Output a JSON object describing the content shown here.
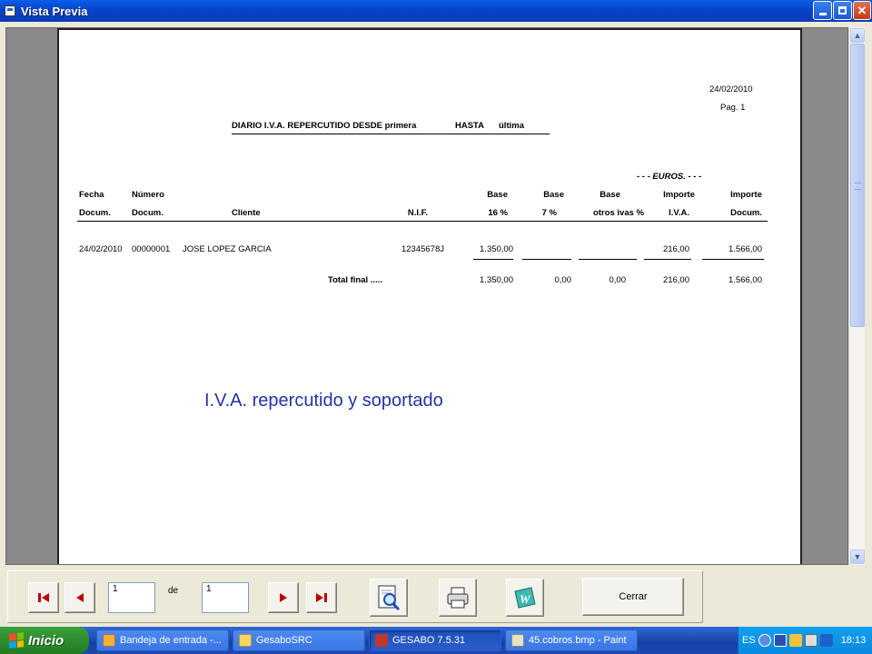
{
  "window": {
    "title": "Vista Previa"
  },
  "report": {
    "date": "24/02/2010",
    "page": "Pag.  1",
    "title": "DIARIO I.V.A. REPERCUTIDO DESDE primera",
    "hasta": "HASTA",
    "hasta_value": "última",
    "currency_caption": "- - - EUROS. - - -",
    "headers_row1": [
      "Fecha",
      "Número",
      "Base",
      "Base",
      "Base",
      "Importe",
      "Importe"
    ],
    "headers_row2": [
      "Docum.",
      "Docum.",
      "Cliente",
      "N.I.F.",
      "16 %",
      "7 %",
      "otros ivas %",
      "I.V.A.",
      "Docum."
    ],
    "rows": [
      {
        "fecha": "24/02/2010",
        "numero": "00000001",
        "cliente": "JOSE LOPEZ GARCIA",
        "nif": "12345678J",
        "base16": "1.350,00",
        "base7": "",
        "otros": "",
        "iva": "216,00",
        "importe": "1.566,00"
      }
    ],
    "total": {
      "label": "Total final .....",
      "base16": "1.350,00",
      "base7": "0,00",
      "otros": "0,00",
      "iva": "216,00",
      "importe": "1.566,00"
    }
  },
  "overlay_text": "I.V.A. repercutido y soportado",
  "toolbar": {
    "current_page": "1",
    "of_label": "de",
    "total_pages": "1",
    "close_label": "Cerrar"
  },
  "taskbar": {
    "start_label": "Inicio",
    "tasks": [
      "Bandeja de entrada -...",
      "GesaboSRC",
      "GESABO 7.5.31",
      "45.cobros.bmp - Paint"
    ],
    "language": "ES",
    "clock": "18:13"
  },
  "colors": {
    "titlebar": "#0843C9",
    "overlay": "#2233A6",
    "taskbar": "#1941A5",
    "start": "#2B8A2B"
  }
}
